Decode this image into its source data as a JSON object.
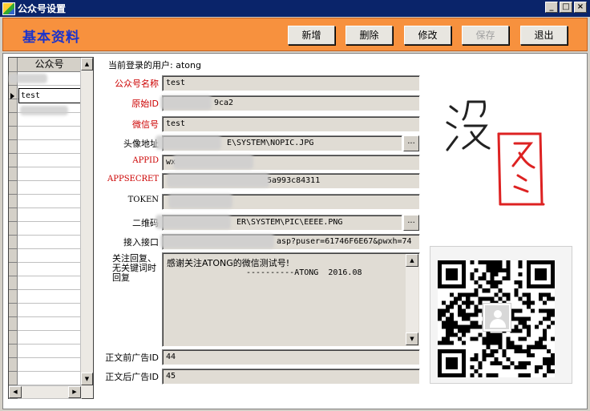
{
  "window": {
    "title": "公众号设置",
    "controls": [
      "_",
      "□",
      "×"
    ]
  },
  "header": {
    "title": "基本资料",
    "buttons": {
      "new": "新增",
      "delete": "删除",
      "edit": "修改",
      "save": "保存",
      "exit": "退出"
    }
  },
  "grid": {
    "column": "公众号",
    "rows": [
      "test"
    ]
  },
  "form": {
    "current_user": "当前登录的用户: atong",
    "fields": {
      "account_name": {
        "label": "公众号名称",
        "value": "test"
      },
      "original_id": {
        "label": "原始ID",
        "value": "9ca2"
      },
      "wechat_id": {
        "label": "微信号",
        "value": "test"
      },
      "avatar_path": {
        "label": "头像地址",
        "value": "E\\SYSTEM\\NOPIC.JPG"
      },
      "appid": {
        "label": "APPID",
        "value": "wx"
      },
      "appsecret": {
        "label": "APPSECRET",
        "value": "5a993c84311"
      },
      "token": {
        "label": "TOKEN",
        "value": ""
      },
      "qrcode_path": {
        "label": "二维码",
        "value": "ER\\SYSTEM\\PIC\\EEEE.PNG"
      },
      "api_url": {
        "label": "接入接口",
        "value": "asp?puser=61746F6E67&pwxh=74"
      },
      "auto_reply": {
        "label": "关注回复、无关键词时回复",
        "line1": "感谢关注ATONG的微信测试号!",
        "line2": "----------ATONG  2016.08"
      },
      "ad_before": {
        "label": "正文前广告ID",
        "value": "44"
      },
      "ad_after": {
        "label": "正文后广告ID",
        "value": "45"
      }
    },
    "ellipsis": "..."
  },
  "logo_text": "没图",
  "colors": {
    "header_bg": "#f7913e",
    "title_blue": "#1a33cc",
    "label_red": "#cc0000",
    "titlebar": "#0a246a"
  }
}
